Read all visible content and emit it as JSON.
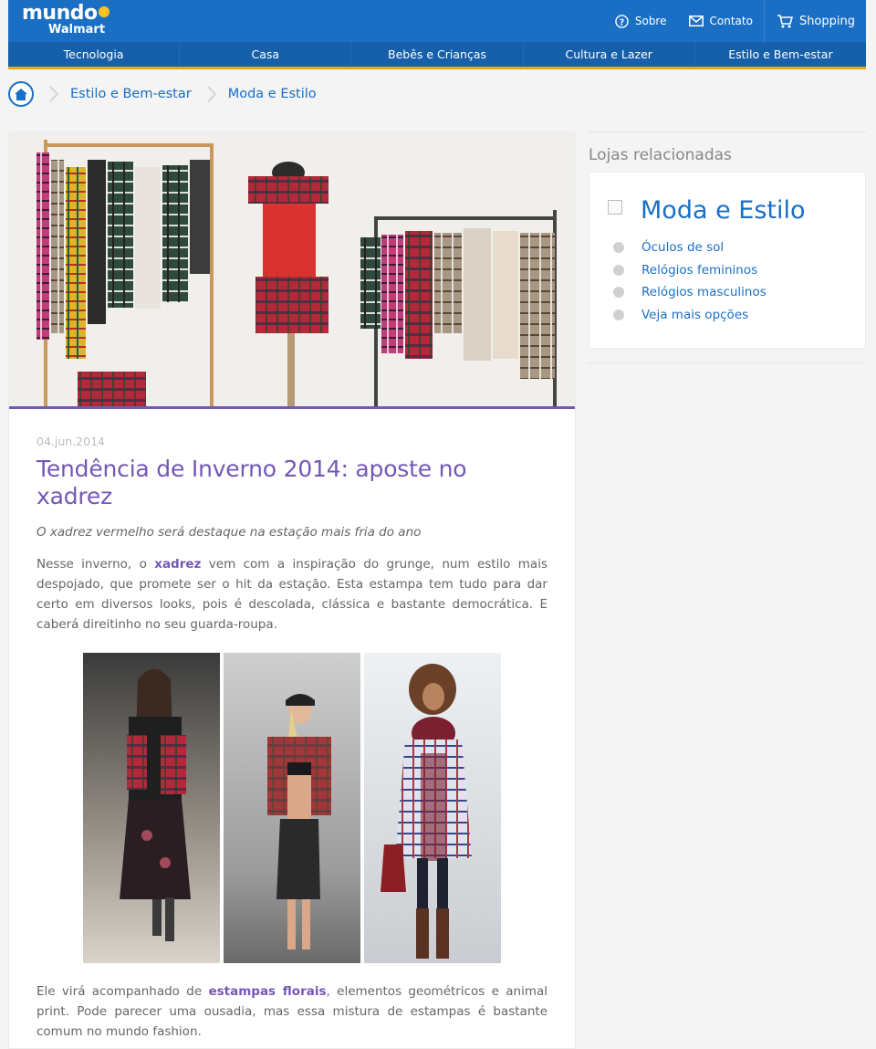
{
  "header": {
    "logo_top": "mundo",
    "logo_bottom": "Walmart",
    "links": [
      {
        "label": "Sobre",
        "icon": "question-circle-icon"
      },
      {
        "label": "Contato",
        "icon": "envelope-icon"
      },
      {
        "label": "Shopping",
        "icon": "cart-icon"
      }
    ]
  },
  "nav": {
    "items": [
      "Tecnologia",
      "Casa",
      "Bebês e Crianças",
      "Cultura e Lazer",
      "Estilo e Bem-estar"
    ]
  },
  "breadcrumb": {
    "items": [
      "Estilo e Bem-estar",
      "Moda e Estilo"
    ]
  },
  "article": {
    "date": "04.jun.2014",
    "title": "Tendência de Inverno 2014: aposte no xadrez",
    "subtitle": "O xadrez vermelho será destaque na estação mais fria do ano",
    "p1_before": "Nesse inverno, o ",
    "p1_link": "xadrez",
    "p1_after": " vem com a inspiração do grunge, num estilo mais despojado, que promete ser o hit da estação. Esta estampa tem tudo para dar certo em diversos looks, pois é descolada, clássica e bastante democrática. E caberá direitinho no seu guarda-roupa.",
    "p2_before": "Ele virá acompanhado de ",
    "p2_link": "estampas florais",
    "p2_after": ", elementos geométricos e animal print. Pode parecer uma ousadia, mas essa mistura de estampas é bastante comum no mundo fashion."
  },
  "sidebar": {
    "heading": "Lojas relacionadas",
    "store_title": "Moda e Estilo",
    "links": [
      "Óculos de sol",
      "Relógios femininos",
      "Relógios masculinos",
      "Veja mais opções"
    ]
  },
  "colors": {
    "brand_blue": "#1a6fc4",
    "nav_blue": "#155fab",
    "accent_yellow": "#ffc220",
    "article_purple": "#7458b6"
  }
}
